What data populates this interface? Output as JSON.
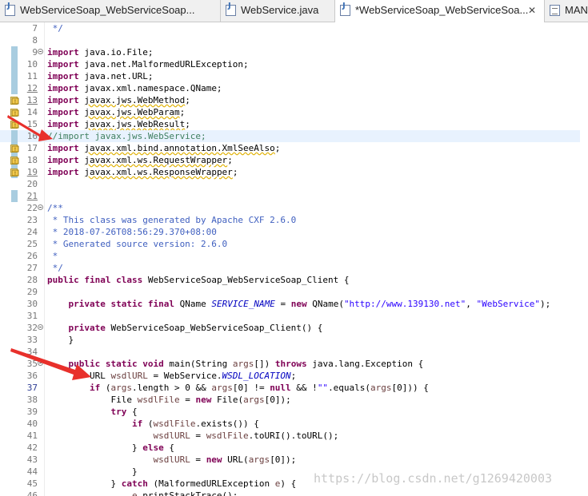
{
  "tabs": [
    {
      "label": "WebServiceSoap_WebServiceSoap...",
      "icon": "java-file-icon",
      "close": ""
    },
    {
      "label": "WebService.java",
      "icon": "java-file-icon",
      "close": ""
    },
    {
      "label": "*WebServiceSoap_WebServiceSoa...",
      "icon": "java-file-icon",
      "close": "✕"
    },
    {
      "label": "MAN",
      "icon": "manifest-file-icon",
      "close": ""
    }
  ],
  "watermark": "https://blog.csdn.net/g1269420003",
  "lines": [
    {
      "n": "7",
      "parts": [
        {
          "t": " */",
          "c": "dc"
        }
      ]
    },
    {
      "n": "8",
      "parts": []
    },
    {
      "n": "9",
      "fold": true,
      "parts": [
        {
          "t": "import",
          "c": "kw"
        },
        {
          "t": " java.io.File;"
        }
      ]
    },
    {
      "n": "10",
      "parts": [
        {
          "t": "import",
          "c": "kw"
        },
        {
          "t": " java.net.MalformedURLException;"
        }
      ]
    },
    {
      "n": "11",
      "parts": [
        {
          "t": "import",
          "c": "kw"
        },
        {
          "t": " java.net.URL;"
        }
      ]
    },
    {
      "n": "12",
      "ul": true,
      "parts": [
        {
          "t": "import",
          "c": "kw"
        },
        {
          "t": " javax.xml.namespace.QName;"
        }
      ]
    },
    {
      "n": "13",
      "ul": true,
      "warn": true,
      "parts": [
        {
          "t": "import",
          "c": "kw"
        },
        {
          "t": " "
        },
        {
          "t": "javax.jws.WebMethod",
          "c": "uw"
        },
        {
          "t": ";"
        }
      ]
    },
    {
      "n": "14",
      "warn": true,
      "parts": [
        {
          "t": "import",
          "c": "kw"
        },
        {
          "t": " "
        },
        {
          "t": "javax.jws.WebParam",
          "c": "uw"
        },
        {
          "t": ";"
        }
      ]
    },
    {
      "n": "15",
      "warn": true,
      "parts": [
        {
          "t": "import",
          "c": "kw"
        },
        {
          "t": " "
        },
        {
          "t": "javax.jws.WebResult",
          "c": "uw"
        },
        {
          "t": ";"
        }
      ]
    },
    {
      "n": "16",
      "current": true,
      "parts": [
        {
          "t": "//import javax.jws.WebService;",
          "c": "cm"
        }
      ]
    },
    {
      "n": "17",
      "warn": true,
      "parts": [
        {
          "t": "import",
          "c": "kw"
        },
        {
          "t": " "
        },
        {
          "t": "javax.xml.bind.annotation.XmlSeeAlso",
          "c": "uw"
        },
        {
          "t": ";"
        }
      ]
    },
    {
      "n": "18",
      "warn": true,
      "parts": [
        {
          "t": "import",
          "c": "kw"
        },
        {
          "t": " "
        },
        {
          "t": "javax.xml.ws.RequestWrapper",
          "c": "uw"
        },
        {
          "t": ";"
        }
      ]
    },
    {
      "n": "19",
      "ul": true,
      "warn": true,
      "parts": [
        {
          "t": "import",
          "c": "kw"
        },
        {
          "t": " "
        },
        {
          "t": "javax.xml.ws.ResponseWrapper",
          "c": "uw"
        },
        {
          "t": ";"
        }
      ]
    },
    {
      "n": "20",
      "parts": []
    },
    {
      "n": "21",
      "ul": true,
      "parts": []
    },
    {
      "n": "22",
      "fold": true,
      "parts": [
        {
          "t": "/**",
          "c": "dc"
        }
      ]
    },
    {
      "n": "23",
      "parts": [
        {
          "t": " * This class was generated by Apache CXF 2.6.0",
          "c": "dc"
        }
      ]
    },
    {
      "n": "24",
      "parts": [
        {
          "t": " * 2018-07-26T08:56:29.370+08:00",
          "c": "dc"
        }
      ]
    },
    {
      "n": "25",
      "parts": [
        {
          "t": " * Generated source version: 2.6.0",
          "c": "dc"
        }
      ]
    },
    {
      "n": "26",
      "parts": [
        {
          "t": " *",
          "c": "dc"
        }
      ]
    },
    {
      "n": "27",
      "parts": [
        {
          "t": " */",
          "c": "dc"
        }
      ]
    },
    {
      "n": "28",
      "parts": [
        {
          "t": "public",
          "c": "kw"
        },
        {
          "t": " "
        },
        {
          "t": "final",
          "c": "kw"
        },
        {
          "t": " "
        },
        {
          "t": "class",
          "c": "kw"
        },
        {
          "t": " WebServiceSoap_WebServiceSoap_Client {"
        }
      ]
    },
    {
      "n": "29",
      "parts": []
    },
    {
      "n": "30",
      "parts": [
        {
          "t": "    "
        },
        {
          "t": "private",
          "c": "kw"
        },
        {
          "t": " "
        },
        {
          "t": "static",
          "c": "kw"
        },
        {
          "t": " "
        },
        {
          "t": "final",
          "c": "kw"
        },
        {
          "t": " QName "
        },
        {
          "t": "SERVICE_NAME",
          "c": "fd"
        },
        {
          "t": " = "
        },
        {
          "t": "new",
          "c": "kw"
        },
        {
          "t": " QName("
        },
        {
          "t": "\"http://www.139130.net\"",
          "c": "st"
        },
        {
          "t": ", "
        },
        {
          "t": "\"WebService\"",
          "c": "st"
        },
        {
          "t": ");"
        }
      ]
    },
    {
      "n": "31",
      "parts": []
    },
    {
      "n": "32",
      "fold": true,
      "parts": [
        {
          "t": "    "
        },
        {
          "t": "private",
          "c": "kw"
        },
        {
          "t": " WebServiceSoap_WebServiceSoap_Client() {"
        }
      ]
    },
    {
      "n": "33",
      "parts": [
        {
          "t": "    }"
        }
      ]
    },
    {
      "n": "34",
      "parts": []
    },
    {
      "n": "35",
      "fold": true,
      "parts": [
        {
          "t": "    "
        },
        {
          "t": "public",
          "c": "kw"
        },
        {
          "t": " "
        },
        {
          "t": "static",
          "c": "kw"
        },
        {
          "t": " "
        },
        {
          "t": "void",
          "c": "kw"
        },
        {
          "t": " main(String "
        },
        {
          "t": "args",
          "c": "vr"
        },
        {
          "t": "[]) "
        },
        {
          "t": "throws",
          "c": "kw"
        },
        {
          "t": " java.lang.Exception {"
        }
      ]
    },
    {
      "n": "36",
      "parts": [
        {
          "t": "        URL "
        },
        {
          "t": "wsdlURL",
          "c": "vr"
        },
        {
          "t": " = WebService."
        },
        {
          "t": "WSDL_LOCATION",
          "c": "fd"
        },
        {
          "t": ";"
        }
      ]
    },
    {
      "n": "37",
      "cur": true,
      "parts": [
        {
          "t": "        "
        },
        {
          "t": "if",
          "c": "kw"
        },
        {
          "t": " ("
        },
        {
          "t": "args",
          "c": "vr"
        },
        {
          "t": ".length > 0 && "
        },
        {
          "t": "args",
          "c": "vr"
        },
        {
          "t": "[0] != "
        },
        {
          "t": "null",
          "c": "kw"
        },
        {
          "t": " && !"
        },
        {
          "t": "\"\"",
          "c": "st"
        },
        {
          "t": ".equals("
        },
        {
          "t": "args",
          "c": "vr"
        },
        {
          "t": "[0])) {"
        }
      ]
    },
    {
      "n": "38",
      "parts": [
        {
          "t": "            File "
        },
        {
          "t": "wsdlFile",
          "c": "vr"
        },
        {
          "t": " = "
        },
        {
          "t": "new",
          "c": "kw"
        },
        {
          "t": " File("
        },
        {
          "t": "args",
          "c": "vr"
        },
        {
          "t": "[0]);"
        }
      ]
    },
    {
      "n": "39",
      "parts": [
        {
          "t": "            "
        },
        {
          "t": "try",
          "c": "kw"
        },
        {
          "t": " {"
        }
      ]
    },
    {
      "n": "40",
      "parts": [
        {
          "t": "                "
        },
        {
          "t": "if",
          "c": "kw"
        },
        {
          "t": " ("
        },
        {
          "t": "wsdlFile",
          "c": "vr"
        },
        {
          "t": ".exists()) {"
        }
      ]
    },
    {
      "n": "41",
      "parts": [
        {
          "t": "                    "
        },
        {
          "t": "wsdlURL",
          "c": "vr"
        },
        {
          "t": " = "
        },
        {
          "t": "wsdlFile",
          "c": "vr"
        },
        {
          "t": ".toURI().toURL();"
        }
      ]
    },
    {
      "n": "42",
      "parts": [
        {
          "t": "                } "
        },
        {
          "t": "else",
          "c": "kw"
        },
        {
          "t": " {"
        }
      ]
    },
    {
      "n": "43",
      "parts": [
        {
          "t": "                    "
        },
        {
          "t": "wsdlURL",
          "c": "vr"
        },
        {
          "t": " = "
        },
        {
          "t": "new",
          "c": "kw"
        },
        {
          "t": " URL("
        },
        {
          "t": "args",
          "c": "vr"
        },
        {
          "t": "[0]);"
        }
      ]
    },
    {
      "n": "44",
      "parts": [
        {
          "t": "                }"
        }
      ]
    },
    {
      "n": "45",
      "parts": [
        {
          "t": "            } "
        },
        {
          "t": "catch",
          "c": "kw"
        },
        {
          "t": " (MalformedURLException "
        },
        {
          "t": "e",
          "c": "vr"
        },
        {
          "t": ") {"
        }
      ]
    },
    {
      "n": "46",
      "parts": [
        {
          "t": "                "
        },
        {
          "t": "e",
          "c": "vr"
        },
        {
          "t": ".printStackTrace();"
        }
      ]
    }
  ]
}
